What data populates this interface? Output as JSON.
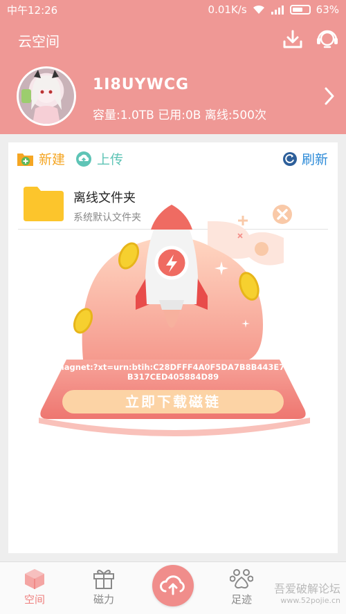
{
  "status_bar": {
    "time": "中午12:26",
    "net_speed": "0.01K/s",
    "battery": "63%",
    "battery_level": 0.63
  },
  "header": {
    "title": "云空间",
    "username": "1I8UYWCG",
    "quota": "容量:1.0TB 已用:0B 离线:500次"
  },
  "actions": {
    "new_label": "新建",
    "upload_label": "上传",
    "refresh_label": "刷新"
  },
  "files": [
    {
      "name": "离线文件夹",
      "desc": "系统默认文件夹"
    }
  ],
  "popup": {
    "magnet": "magnet:?xt=urn:btih:C28DFFF4A0F5DA7B8B443E77B317CED405884D89",
    "download_label": "立即下载磁链"
  },
  "nav": [
    {
      "label": "空间",
      "icon": "cube-icon",
      "active": true
    },
    {
      "label": "磁力",
      "icon": "gift-icon",
      "active": false
    },
    {
      "label": "",
      "icon": "cloud-upload-icon",
      "active": false
    },
    {
      "label": "足迹",
      "icon": "paw-icon",
      "active": false
    }
  ],
  "watermark": {
    "text": "吾爱破解论坛",
    "url": "www.52pojie.cn"
  },
  "colors": {
    "header": "#ef9895",
    "new": "#f5a623",
    "upload": "#5ec4b6",
    "refresh": "#2d8bd8",
    "accent": "#ef7f7d"
  }
}
